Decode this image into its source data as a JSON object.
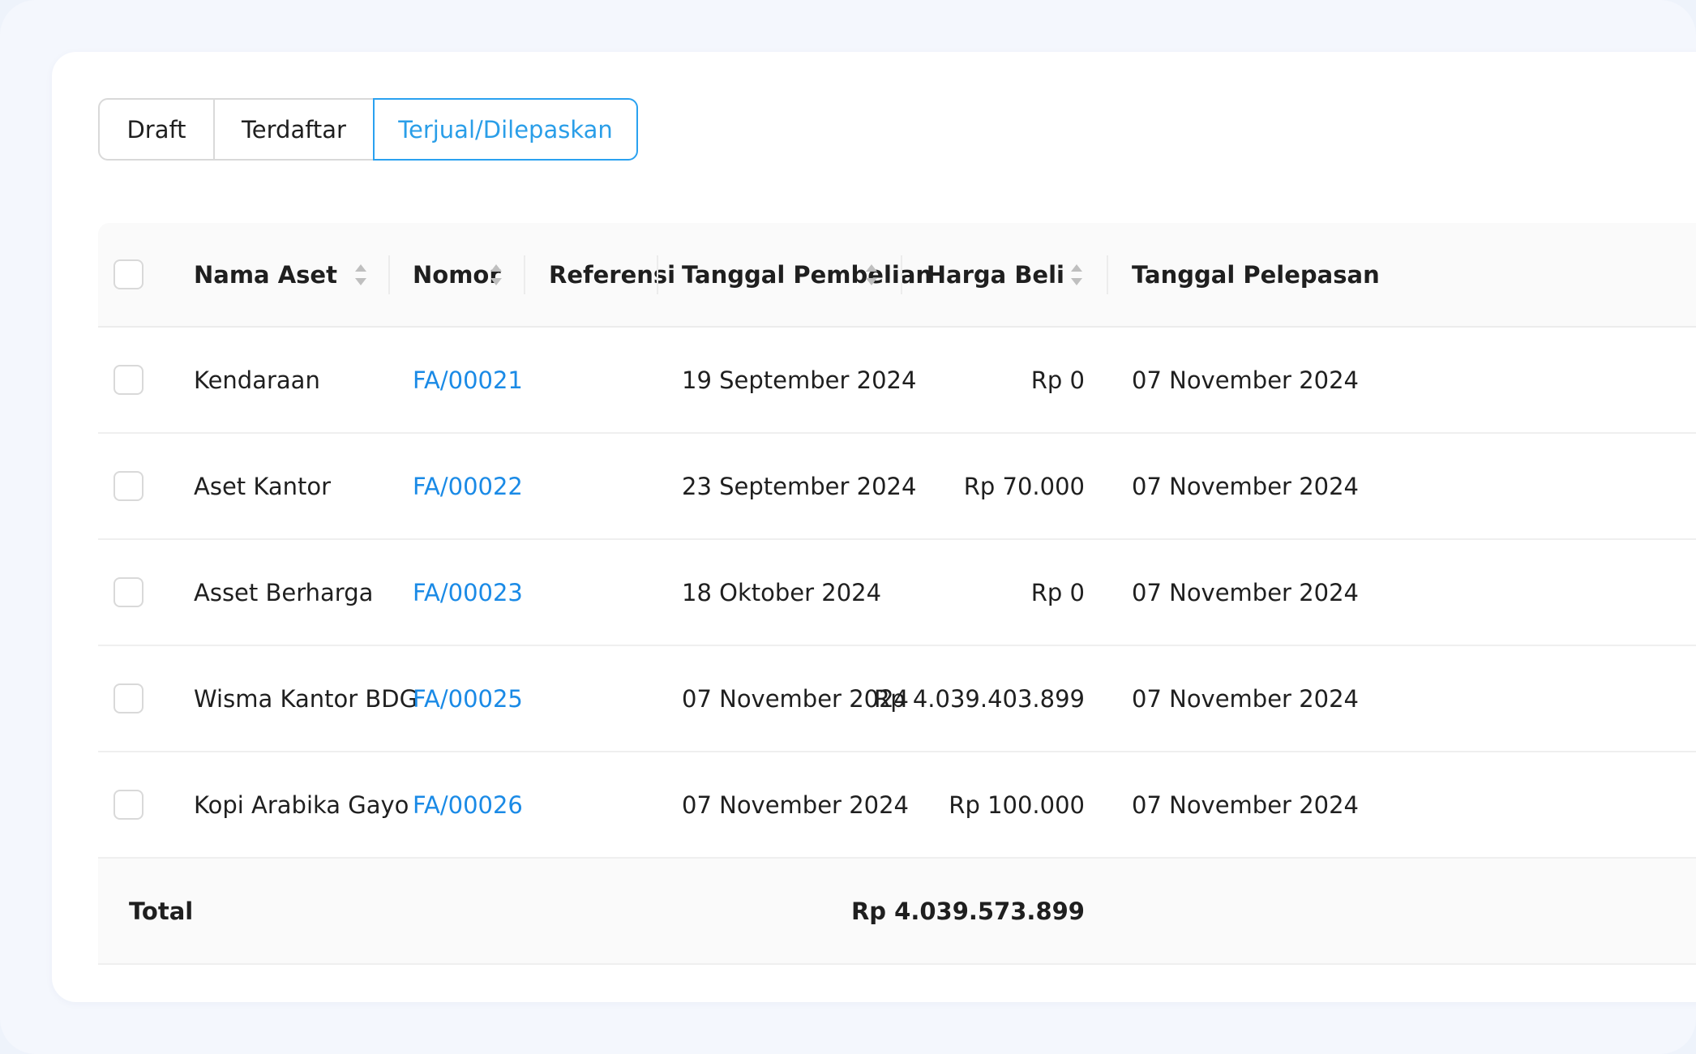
{
  "tabs": {
    "draft": "Draft",
    "registered": "Terdaftar",
    "sold": "Terjual/Dilepaskan"
  },
  "table": {
    "columns": {
      "name": "Nama Aset",
      "number": "Nomor",
      "reference": "Referensi",
      "purchase_date": "Tanggal Pembelian",
      "price": "Harga Beli",
      "disposal_date": "Tanggal Pelepasan"
    },
    "rows": [
      {
        "name": "Kendaraan",
        "number": "FA/00021",
        "reference": "",
        "purchase_date": "19 September 2024",
        "price": "Rp 0",
        "disposal_date": "07 November 2024"
      },
      {
        "name": "Aset Kantor",
        "number": "FA/00022",
        "reference": "",
        "purchase_date": "23 September 2024",
        "price": "Rp 70.000",
        "disposal_date": "07 November 2024"
      },
      {
        "name": "Asset Berharga",
        "number": "FA/00023",
        "reference": "",
        "purchase_date": "18 Oktober 2024",
        "price": "Rp 0",
        "disposal_date": "07 November 2024"
      },
      {
        "name": "Wisma Kantor BDG",
        "number": "FA/00025",
        "reference": "",
        "purchase_date": "07 November 2024",
        "price": "Rp 4.039.403.899",
        "disposal_date": "07 November 2024"
      },
      {
        "name": "Kopi Arabika Gayo",
        "number": "FA/00026",
        "reference": "",
        "purchase_date": "07 November 2024",
        "price": "Rp 100.000",
        "disposal_date": "07 November 2024"
      }
    ],
    "total": {
      "label": "Total",
      "price": "Rp 4.039.573.899"
    }
  },
  "colors": {
    "accent": "#2aa1f0",
    "link": "#1a8ae6",
    "background": "#f4f7fd"
  },
  "icons": [
    "sort-icon"
  ]
}
